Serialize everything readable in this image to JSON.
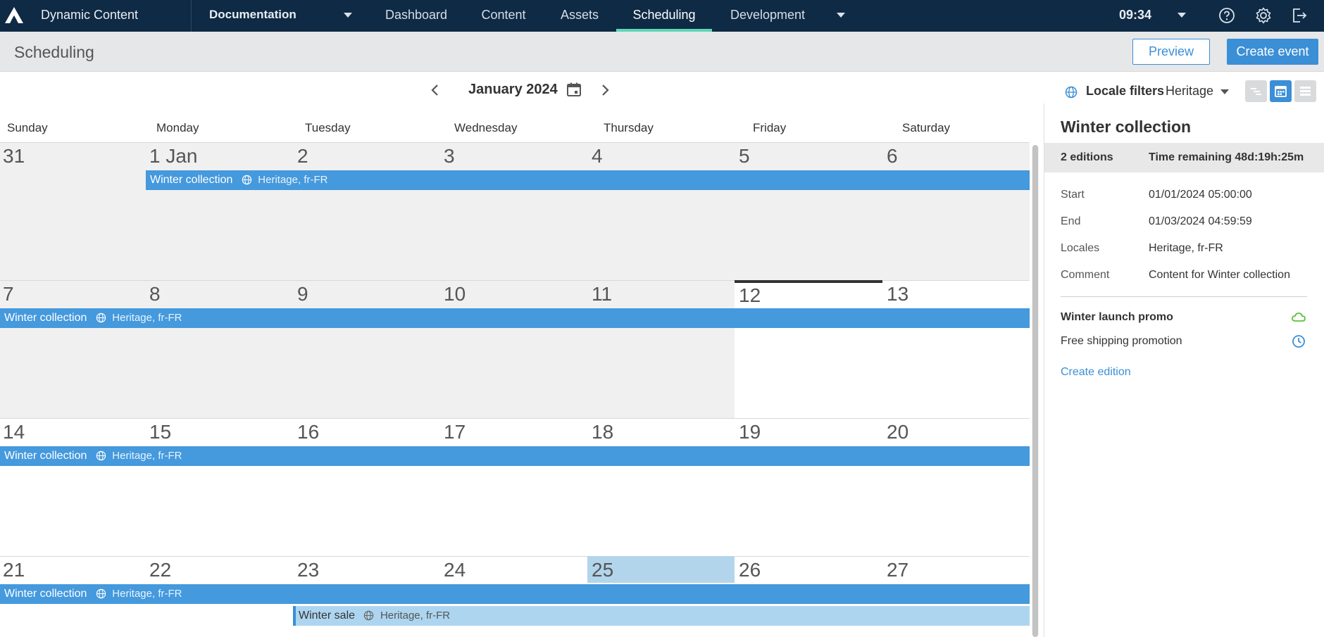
{
  "topnav": {
    "app_name": "Dynamic Content",
    "hub": "Documentation",
    "tabs": [
      "Dashboard",
      "Content",
      "Assets",
      "Scheduling",
      "Development"
    ],
    "active_tab": "Scheduling",
    "time": "09:34",
    "icons": [
      "help-icon",
      "gear-icon",
      "logout-icon"
    ]
  },
  "subheader": {
    "title": "Scheduling",
    "preview_label": "Preview",
    "create_event_label": "Create event"
  },
  "calendar": {
    "month_label": "January 2024",
    "locale_filters_label": "Locale filters",
    "locale_value": "Heritage",
    "weekdays": [
      "Sunday",
      "Monday",
      "Tuesday",
      "Wednesday",
      "Thursday",
      "Friday",
      "Saturday"
    ],
    "weeks": [
      [
        "31",
        "1 Jan",
        "2",
        "3",
        "4",
        "5",
        "6"
      ],
      [
        "7",
        "8",
        "9",
        "10",
        "11",
        "12",
        "13"
      ],
      [
        "14",
        "15",
        "16",
        "17",
        "18",
        "19",
        "20"
      ],
      [
        "21",
        "22",
        "23",
        "24",
        "25",
        "26",
        "27"
      ]
    ],
    "events": [
      {
        "title": "Winter collection",
        "locales": "Heritage, fr-FR"
      },
      {
        "title": "Winter collection",
        "locales": "Heritage, fr-FR"
      },
      {
        "title": "Winter collection",
        "locales": "Heritage, fr-FR"
      },
      {
        "title": "Winter collection",
        "locales": "Heritage, fr-FR"
      },
      {
        "title": "Winter sale",
        "locales": "Heritage, fr-FR"
      }
    ]
  },
  "panel": {
    "title": "Winter collection",
    "editions": "2 editions",
    "time_remaining": "Time remaining 48d:19h:25m",
    "details": [
      {
        "label": "Start",
        "value": "01/01/2024 05:00:00"
      },
      {
        "label": "End",
        "value": "01/03/2024 04:59:59"
      },
      {
        "label": "Locales",
        "value": "Heritage, fr-FR"
      },
      {
        "label": "Comment",
        "value": "Content for Winter collection"
      }
    ],
    "edition_items": [
      {
        "name": "Winter launch promo",
        "status_icon": "cloud-published-icon",
        "status_color": "#5fbf3a"
      },
      {
        "name": "Free shipping promotion",
        "status_icon": "clock-scheduled-icon",
        "status_color": "#3b8fd6"
      }
    ],
    "create_edition_label": "Create edition"
  }
}
